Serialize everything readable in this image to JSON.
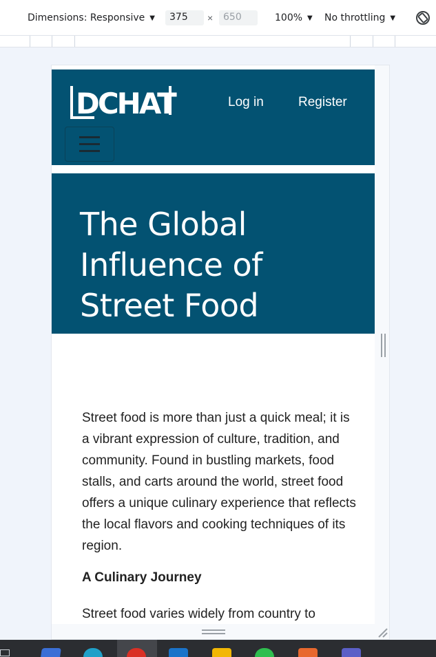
{
  "devtools": {
    "dimensions_label": "Dimensions: Responsive",
    "width_value": "375",
    "height_placeholder": "650",
    "times": "×",
    "zoom": "100%",
    "throttling": "No throttling"
  },
  "site": {
    "logo_text": "DCHAT",
    "nav": {
      "login": "Log in",
      "register": "Register"
    }
  },
  "article": {
    "title": "The Global Influence of Street Food",
    "intro": "Street food is more than just a quick meal; it is a vibrant expression of culture, tradition, and community. Found in bustling markets, food stalls, and carts around the world, street food offers a unique culinary experience that reflects the local flavors and cooking techniques of its region.",
    "section_heading": "A Culinary Journey",
    "section_text": "Street food varies widely from country to"
  },
  "colors": {
    "brand": "#035272",
    "taskbar": "#2b2d31"
  },
  "taskbar": {
    "icons": [
      "task-view-icon",
      "app-icon",
      "edge-icon",
      "chrome-icon",
      "outlook-icon",
      "file-explorer-icon",
      "whatsapp-icon",
      "powerpoint-icon",
      "teams-icon"
    ]
  }
}
